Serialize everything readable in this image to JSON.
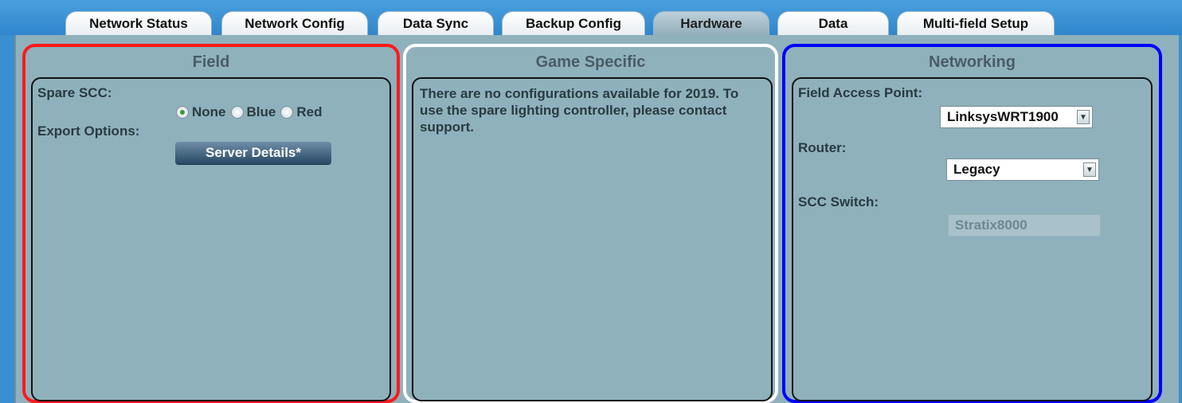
{
  "tabs": [
    {
      "label": "Network Status"
    },
    {
      "label": "Network Config"
    },
    {
      "label": "Data Sync"
    },
    {
      "label": "Backup Config"
    },
    {
      "label": "Hardware",
      "active": true
    },
    {
      "label": "Data"
    },
    {
      "label": "Multi-field Setup"
    }
  ],
  "field": {
    "title": "Field",
    "spare_scc_label": "Spare SCC:",
    "radio_options": [
      "None",
      "Blue",
      "Red"
    ],
    "radio_selected": "None",
    "export_label": "Export Options:",
    "server_details_button": "Server Details*"
  },
  "game": {
    "title": "Game Specific",
    "message": "There are no configurations available for 2019. To use the spare lighting controller, please contact support."
  },
  "networking": {
    "title": "Networking",
    "access_point_label": "Field Access Point:",
    "access_point_value": "LinksysWRT1900",
    "router_label": "Router:",
    "router_value": "Legacy",
    "scc_switch_label": "SCC Switch:",
    "scc_switch_value": "Stratix8000"
  },
  "colors": {
    "field_border": "#ff1a1a",
    "game_border": "#ffffff",
    "networking_border": "#0000ff",
    "panel_bg": "#8fb1bc",
    "page_bg": "#3a8fd0"
  }
}
